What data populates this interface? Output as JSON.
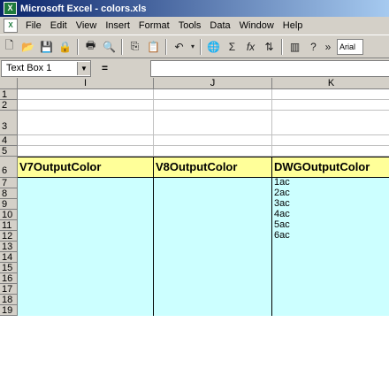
{
  "window": {
    "title": "Microsoft Excel - colors.xls",
    "app_icon": "X"
  },
  "menu": [
    "File",
    "Edit",
    "View",
    "Insert",
    "Format",
    "Tools",
    "Data",
    "Window",
    "Help"
  ],
  "toolbar": {
    "buttons": [
      "new-icon",
      "open-icon",
      "save-icon",
      "permission-icon",
      "print-icon",
      "print-preview-icon",
      "copy-icon",
      "paste-icon",
      "undo-icon",
      "hyperlink-icon",
      "autosum-icon",
      "function-icon",
      "sort-icon",
      "chart-wizard-icon",
      "help-icon",
      "more-buttons-icon"
    ],
    "font": "Arial"
  },
  "formula_bar": {
    "name_box": "Text Box 1",
    "equals": "="
  },
  "columns": [
    "I",
    "J",
    "K"
  ],
  "rows": [
    "1",
    "2",
    "3",
    "4",
    "5",
    "6",
    "7",
    "8",
    "9",
    "10",
    "11",
    "12",
    "13",
    "14",
    "15",
    "16",
    "17",
    "18",
    "19"
  ],
  "headers": [
    "V7OutputColor",
    "V8OutputColor",
    "DWGOutputColor"
  ],
  "k_values": [
    "1ac",
    "2ac",
    "3ac",
    "4ac",
    "5ac",
    "6ac"
  ]
}
